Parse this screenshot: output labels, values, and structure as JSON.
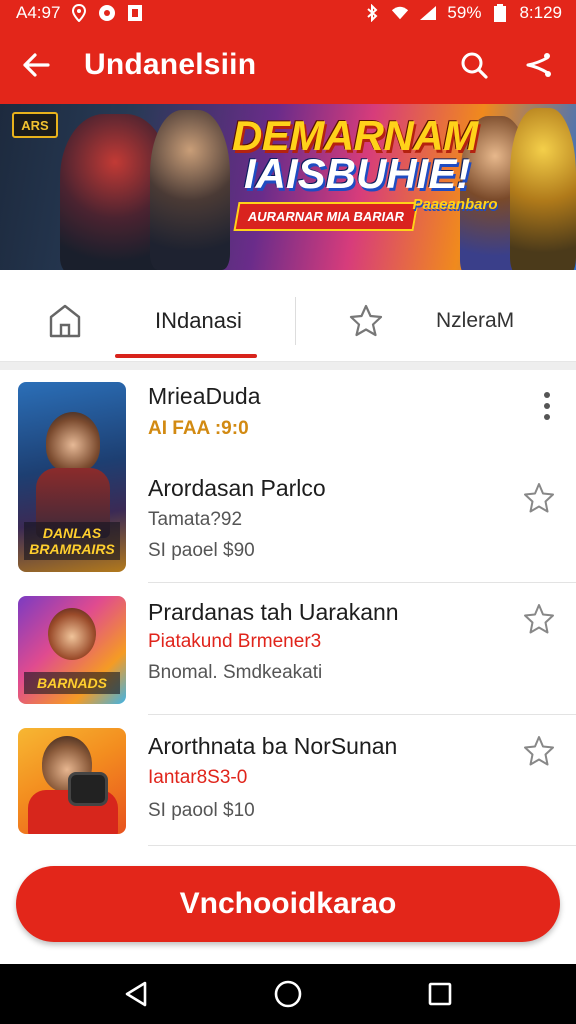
{
  "status_bar": {
    "time": "A4:97",
    "battery": "59%",
    "clock": "8:129"
  },
  "app_bar": {
    "title": "Undanelsiin"
  },
  "banner": {
    "badge": "ARS",
    "title_line1": "DEMARNAM",
    "title_line2": "IAISBUHIE!",
    "strip_text": "AURARNAR MIA BARIAR",
    "side_text": "Paaeanbaro"
  },
  "tabs": {
    "items": [
      {
        "label": "INdanasi"
      },
      {
        "label": "NzleraM"
      }
    ]
  },
  "list": [
    {
      "title": "MrieaDuda",
      "subtitle": "AI FAA :9:0",
      "image_caption": "DANLAS BRAMRAIRS"
    },
    {
      "title": "Arordasan Parlco",
      "meta1": "Tamata?92",
      "meta2": "SI paoel $90"
    },
    {
      "title": "Prardanas tah Uarakann",
      "subtitle": "Piatakund Brmener3",
      "meta1": "Bnomal. Smdkeakati",
      "image_caption": "BARNADS"
    },
    {
      "title": "Arorthnata ba NorSunan",
      "subtitle": "Iantar8S3-0",
      "meta1": "SI paool $10"
    }
  ],
  "cta": {
    "label": "Vnchooidkarao"
  },
  "colors": {
    "primary": "#e3261a",
    "accent_gold": "#d28a12"
  },
  "icons": [
    "back-arrow-icon",
    "search-icon",
    "share-icon",
    "home-icon",
    "star-icon",
    "more-vert-icon",
    "nav-back-icon",
    "nav-home-icon",
    "nav-recents-icon"
  ]
}
